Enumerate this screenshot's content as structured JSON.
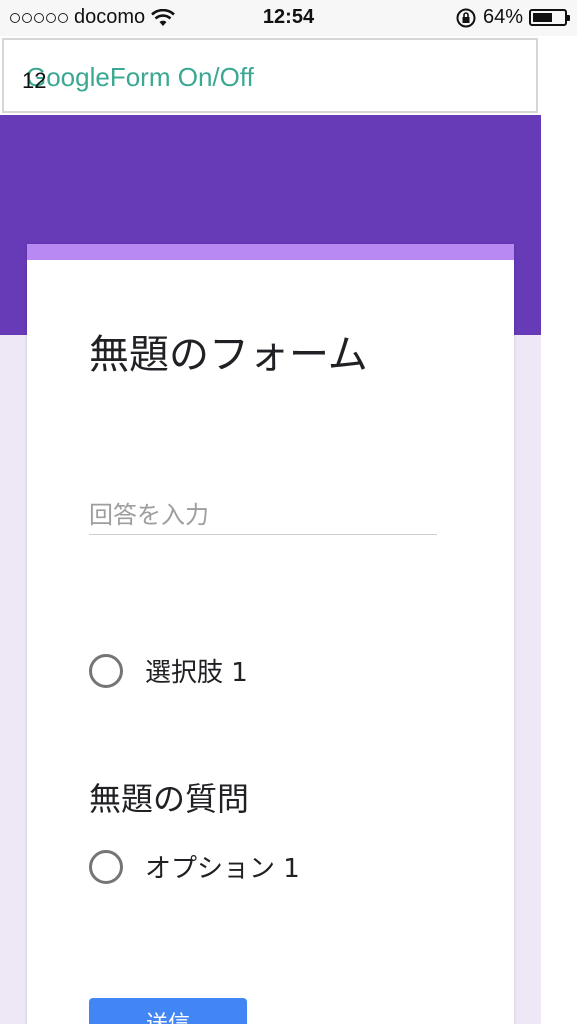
{
  "status_bar": {
    "carrier": "docomo",
    "time": "12:54",
    "battery_percent": "64%",
    "battery_level": 0.64,
    "icons": [
      "signal-dots-icon",
      "wifi-icon",
      "orientation-lock-icon",
      "battery-icon"
    ]
  },
  "app_bar": {
    "title": "GoogleForm On/Off",
    "count": "12"
  },
  "form": {
    "theme_color": "#673ab7",
    "accent_color": "#b889f2",
    "background_color": "#ede7f6",
    "title": "無題のフォーム",
    "answer_placeholder": "回答を入力",
    "choice_1": "選択肢 1",
    "question_title": "無題の質問",
    "option_1": "オプション 1",
    "submit_label": "送信",
    "submit_color": "#4285f4"
  }
}
